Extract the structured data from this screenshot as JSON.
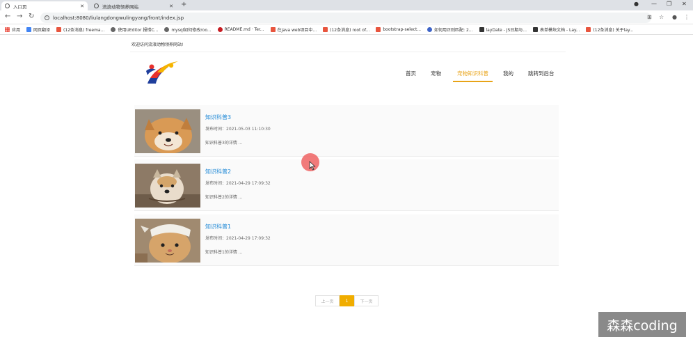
{
  "browser": {
    "tabs": [
      {
        "title": "入口页",
        "active": true
      },
      {
        "title": "流浪动物领养网站",
        "active": false
      }
    ],
    "url": "localhost:8080/liulangdongwulingyang/front/index.jsp",
    "bookmarks": [
      {
        "label": "应用",
        "color": "#e94235"
      },
      {
        "label": "网页翻译",
        "color": "#4285f4"
      },
      {
        "label": "(12条消息) freema...",
        "color": "#e8553e"
      },
      {
        "label": "使用UEditor 报错C...",
        "color": "#666666"
      },
      {
        "label": "mysql如何修改roo...",
        "color": "#666666"
      },
      {
        "label": "README.md · Ter...",
        "color": "#c71d23"
      },
      {
        "label": "在java web项目中...",
        "color": "#e8553e"
      },
      {
        "label": "(12条消息) root of...",
        "color": "#e8553e"
      },
      {
        "label": "bootstrap-select...",
        "color": "#e8553e"
      },
      {
        "label": "如何用正则匹配: 2...",
        "color": "#3e64c8"
      },
      {
        "label": "layDate - JS日期与...",
        "color": "#333333"
      },
      {
        "label": "表单模块文档 - Lay...",
        "color": "#333333"
      },
      {
        "label": "(12条消息) 关于lay...",
        "color": "#e8553e"
      }
    ]
  },
  "site": {
    "welcome": "欢迎访问流浪动物领养网站!",
    "menu": [
      {
        "label": "首页",
        "active": false
      },
      {
        "label": "宠物",
        "active": false
      },
      {
        "label": "宠物知识科普",
        "active": true
      },
      {
        "label": "我的",
        "active": false
      },
      {
        "label": "跳转到后台",
        "active": false
      }
    ],
    "accent": "#e8a317",
    "link_color": "#1e88d6"
  },
  "articles": [
    {
      "title": "知识科普3",
      "time": "发布时间：2021-05-03 11:10:30",
      "desc": "知识科普3的详情 ..."
    },
    {
      "title": "知识科普2",
      "time": "发布时间：2021-04-29 17:09:32",
      "desc": "知识科普2的详情 ..."
    },
    {
      "title": "知识科普1",
      "time": "发布时间：2021-04-29 17:09:32",
      "desc": "知识科普1的详情 ..."
    }
  ],
  "pagination": {
    "prev": "上一页",
    "current": "1",
    "next": "下一页"
  },
  "watermark": "森森coding"
}
